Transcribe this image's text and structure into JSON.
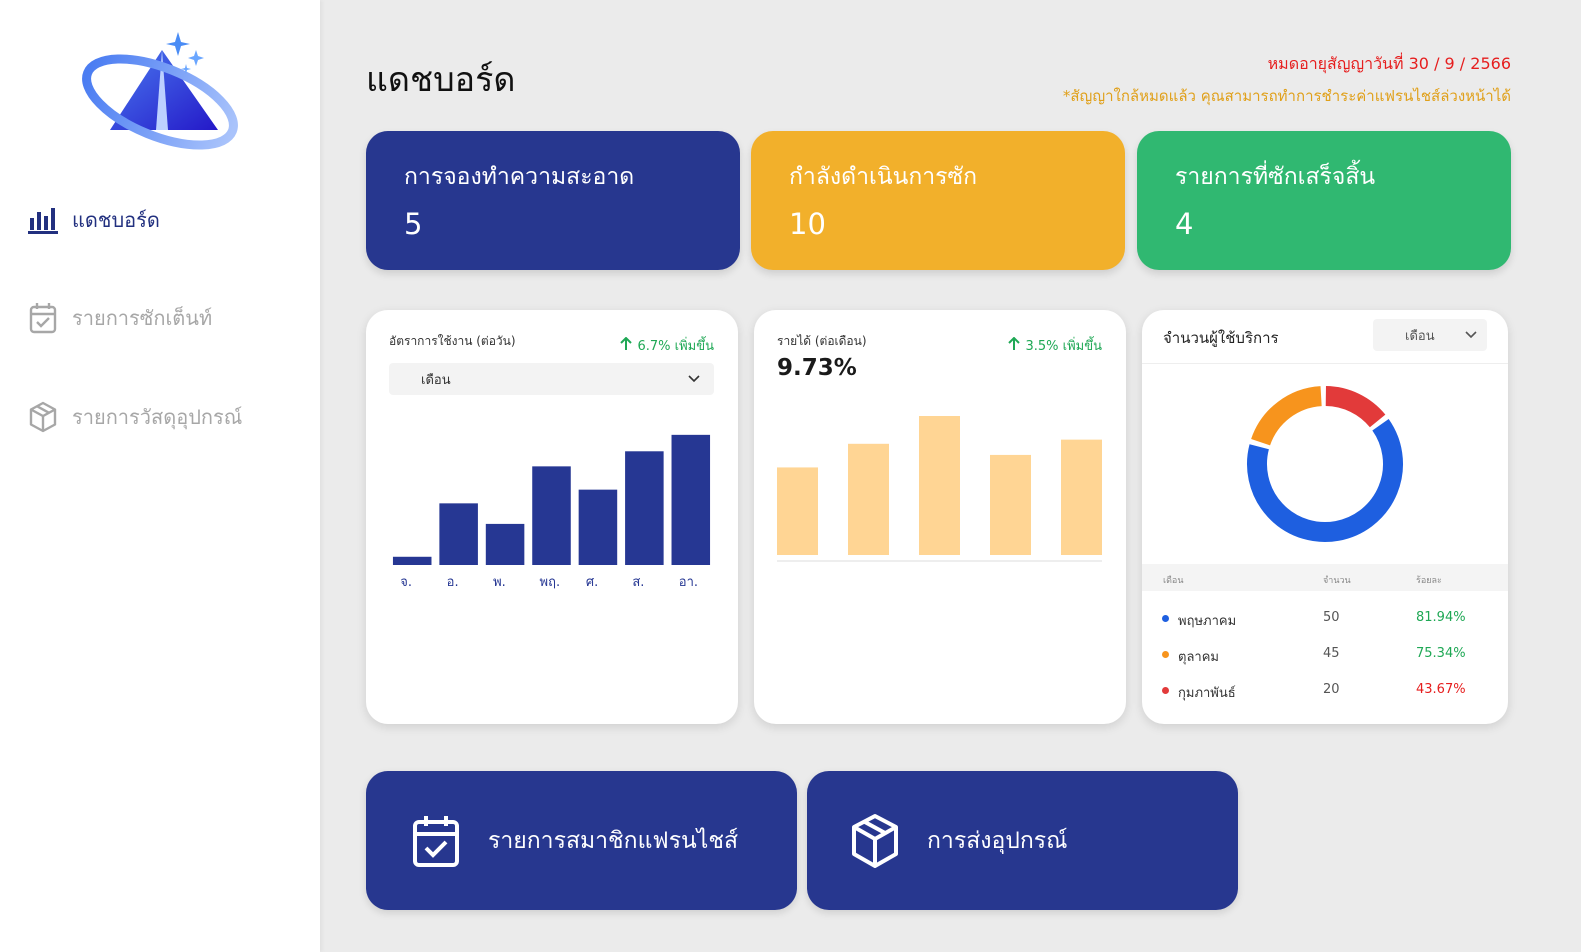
{
  "sidebar": {
    "items": [
      {
        "label": "แดชบอร์ด",
        "icon": "bar-chart-icon"
      },
      {
        "label": "รายการซักเต็นท์",
        "icon": "calendar-check-icon"
      },
      {
        "label": "รายการวัสดุอุปกรณ์",
        "icon": "package-icon"
      }
    ]
  },
  "header": {
    "title": "แดชบอร์ด",
    "expiry": "หมดอายุสัญญาวันที่  30 / 9 / 2566",
    "warning": "*สัญญาใกล้หมดแล้ว คุณสามารถทำการชำระค่าแฟรนไชส์ล่วงหน้าได้"
  },
  "stats": [
    {
      "label": "การจองทำความสะอาด",
      "value": "5",
      "color": "#27378f"
    },
    {
      "label": "กำลังดำเนินการซัก",
      "value": "10",
      "color": "#f2b02b"
    },
    {
      "label": "รายการที่ซักเสร็จสิ้น",
      "value": "4",
      "color": "#30b871"
    }
  ],
  "usage_panel": {
    "title": "อัตราการใช้งาน (ต่อวัน)",
    "trend": "6.7% เพิ่มขึ้น",
    "select": "เดือน"
  },
  "income_panel": {
    "title": "รายได้ (ต่อเดือน)",
    "trend": "3.5% เพิ่มขึ้น",
    "value": "9.73%"
  },
  "users_panel": {
    "title": "จำนวนผู้ใช้บริการ",
    "select": "เดือน",
    "columns": [
      "เดือน",
      "จำนวน",
      "ร้อยละ"
    ],
    "rows": [
      {
        "name": "พฤษภาคม",
        "count": "50",
        "pct": "81.94%",
        "dot": "#1e5fe0",
        "pct_color": "#1fa855"
      },
      {
        "name": "ตุลาคม",
        "count": "45",
        "pct": "75.34%",
        "dot": "#f7941d",
        "pct_color": "#1fa855"
      },
      {
        "name": "กุมภาพันธ์",
        "count": "20",
        "pct": "43.67%",
        "dot": "#e23a3a",
        "pct_color": "#e61e1e"
      }
    ]
  },
  "actions": [
    {
      "label": "รายการสมาชิกแฟรนไชส์",
      "icon": "calendar-check-icon"
    },
    {
      "label": "การส่งอุปกรณ์",
      "icon": "package-icon"
    }
  ],
  "chart_data": [
    {
      "type": "bar",
      "title": "อัตราการใช้งาน (ต่อวัน)",
      "categories": [
        "จ.",
        "อ.",
        "พ.",
        "พฤ.",
        "ศ.",
        "ส.",
        "อา."
      ],
      "values": [
        6,
        45,
        30,
        72,
        55,
        83,
        95
      ],
      "ylim": [
        0,
        100
      ],
      "color": "#263793"
    },
    {
      "type": "bar",
      "title": "รายได้ (ต่อเดือน)",
      "categories": [
        "",
        "",
        "",
        "",
        ""
      ],
      "values": [
        63,
        80,
        100,
        72,
        83
      ],
      "ylim": [
        0,
        100
      ],
      "color": "#ffd594"
    },
    {
      "type": "pie",
      "title": "จำนวนผู้ใช้บริการ",
      "labels": [
        "พฤษภาคม",
        "ตุลาคม",
        "กุมภาพันธ์"
      ],
      "values": [
        65,
        20,
        15
      ],
      "colors": [
        "#1e5fe0",
        "#f7941d",
        "#e23a3a"
      ]
    }
  ]
}
